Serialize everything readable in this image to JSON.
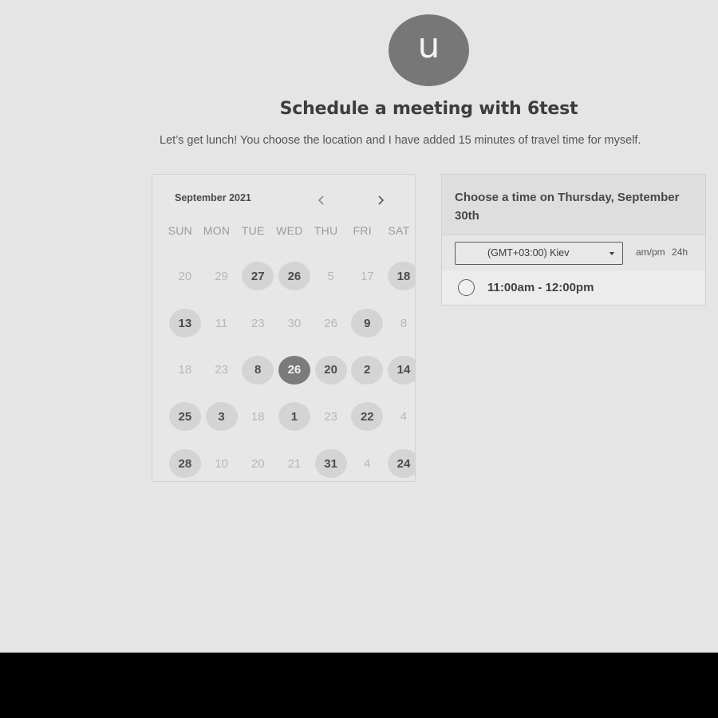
{
  "host": {
    "avatar_letter": "u",
    "title": "Schedule a meeting with 6test",
    "description": "Let’s get lunch! You choose the location and I have added 15 minutes of travel time for myself."
  },
  "calendar": {
    "month_label": "September 2021",
    "prev_icon": "chevron-left-icon",
    "next_icon": "chevron-right-icon",
    "weekdays": [
      "SUN",
      "MON",
      "TUE",
      "WED",
      "THU",
      "FRI",
      "SAT"
    ],
    "weeks": [
      [
        {
          "d": "20",
          "s": "off"
        },
        {
          "d": "29",
          "s": "off"
        },
        {
          "d": "27",
          "s": "available"
        },
        {
          "d": "26",
          "s": "available"
        },
        {
          "d": "5",
          "s": "off"
        },
        {
          "d": "17",
          "s": "off"
        },
        {
          "d": "18",
          "s": "available"
        }
      ],
      [
        {
          "d": "13",
          "s": "available"
        },
        {
          "d": "11",
          "s": "off"
        },
        {
          "d": "23",
          "s": "off"
        },
        {
          "d": "30",
          "s": "off"
        },
        {
          "d": "26",
          "s": "off"
        },
        {
          "d": "9",
          "s": "available"
        },
        {
          "d": "8",
          "s": "off"
        }
      ],
      [
        {
          "d": "18",
          "s": "off"
        },
        {
          "d": "23",
          "s": "off"
        },
        {
          "d": "8",
          "s": "available"
        },
        {
          "d": "26",
          "s": "selected"
        },
        {
          "d": "20",
          "s": "available"
        },
        {
          "d": "2",
          "s": "available"
        },
        {
          "d": "14",
          "s": "available"
        }
      ],
      [
        {
          "d": "25",
          "s": "available"
        },
        {
          "d": "3",
          "s": "available"
        },
        {
          "d": "18",
          "s": "off"
        },
        {
          "d": "1",
          "s": "available"
        },
        {
          "d": "23",
          "s": "off"
        },
        {
          "d": "22",
          "s": "available"
        },
        {
          "d": "4",
          "s": "off"
        }
      ],
      [
        {
          "d": "28",
          "s": "available"
        },
        {
          "d": "10",
          "s": "off"
        },
        {
          "d": "20",
          "s": "off"
        },
        {
          "d": "21",
          "s": "off"
        },
        {
          "d": "31",
          "s": "available"
        },
        {
          "d": "4",
          "s": "off"
        },
        {
          "d": "24",
          "s": "available"
        }
      ]
    ]
  },
  "time_panel": {
    "heading": "Choose a time on Thursday, September 30th",
    "timezone_value": "(GMT+03:00) Kiev",
    "format_options": [
      "am/pm",
      "24h"
    ],
    "slots": [
      "11:00am - 12:00pm"
    ]
  },
  "colors": {
    "page_background": "#e5e5e5",
    "bottom_bar": "#000000",
    "selected_day": "#7b7b7b",
    "available_day": "#d4d4d4"
  }
}
